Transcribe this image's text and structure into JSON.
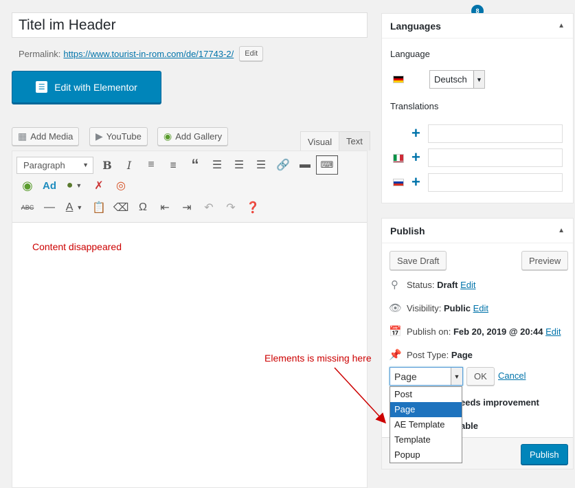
{
  "editor": {
    "title_value": "Titel im Header",
    "permalink_label": "Permalink:",
    "permalink_url": "https://www.tourist-in-rom.com/de/17743-2/",
    "permalink_edit": "Edit",
    "elementor_button": "Edit with Elementor",
    "media_buttons": {
      "add_media": "Add Media",
      "youtube": "YouTube",
      "add_gallery": "Add Gallery"
    },
    "tabs": {
      "visual": "Visual",
      "text": "Text"
    },
    "format_select": "Paragraph",
    "toolbar_ad": "Ad",
    "content_note": "Content disappeared"
  },
  "notification_badge": "8",
  "languages": {
    "title": "Languages",
    "language_label": "Language",
    "language_selected": "Deutsch",
    "translations_label": "Translations"
  },
  "publish": {
    "title": "Publish",
    "save_draft": "Save Draft",
    "preview": "Preview",
    "status_label": "Status:",
    "status_value": "Draft",
    "visibility_label": "Visibility:",
    "visibility_value": "Public",
    "publish_on_label": "Publish on:",
    "publish_on_value": "Feb 20, 2019 @ 20:44",
    "post_type_label": "Post Type:",
    "post_type_value": "Page",
    "edit": "Edit",
    "type_select_value": "Page",
    "ok": "OK",
    "cancel": "Cancel",
    "seo_partial": "eeds improvement",
    "readability_partial": "able",
    "publish_button": "Publish",
    "type_options": [
      "Post",
      "Page",
      "AE Template",
      "Template",
      "Popup"
    ]
  },
  "annotation": {
    "missing_note": "Elements is missing here",
    "color": "#cc0000"
  },
  "colors": {
    "primary": "#0085ba",
    "link": "#0073aa",
    "selected_option": "#1e73be"
  }
}
